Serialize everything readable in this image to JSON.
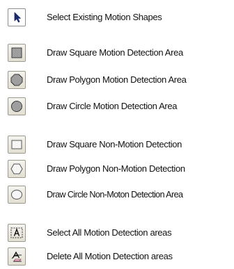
{
  "legend": {
    "items": [
      {
        "icon": "select-arrow-icon",
        "label": "Select Existing Motion Shapes"
      },
      {
        "icon": "square-motion-icon",
        "label": "Draw Square Motion Detection Area"
      },
      {
        "icon": "polygon-motion-icon",
        "label": "Draw Polygon Motion Detection Area"
      },
      {
        "icon": "circle-motion-icon",
        "label": "Draw Circle  Motion Detection Area"
      },
      {
        "icon": "square-non-motion-icon",
        "label": "Draw Square Non-Motion Detection"
      },
      {
        "icon": "polygon-non-motion-icon",
        "label": "Draw Polygon Non-Motion Detection"
      },
      {
        "icon": "circle-non-motion-icon",
        "label": "Draw Circle  Non-Moton Detection Area"
      },
      {
        "icon": "select-all-icon",
        "label": "Select All Motion Detection areas"
      },
      {
        "icon": "delete-all-icon",
        "label": "Delete  All Motion Detection areas"
      }
    ]
  }
}
